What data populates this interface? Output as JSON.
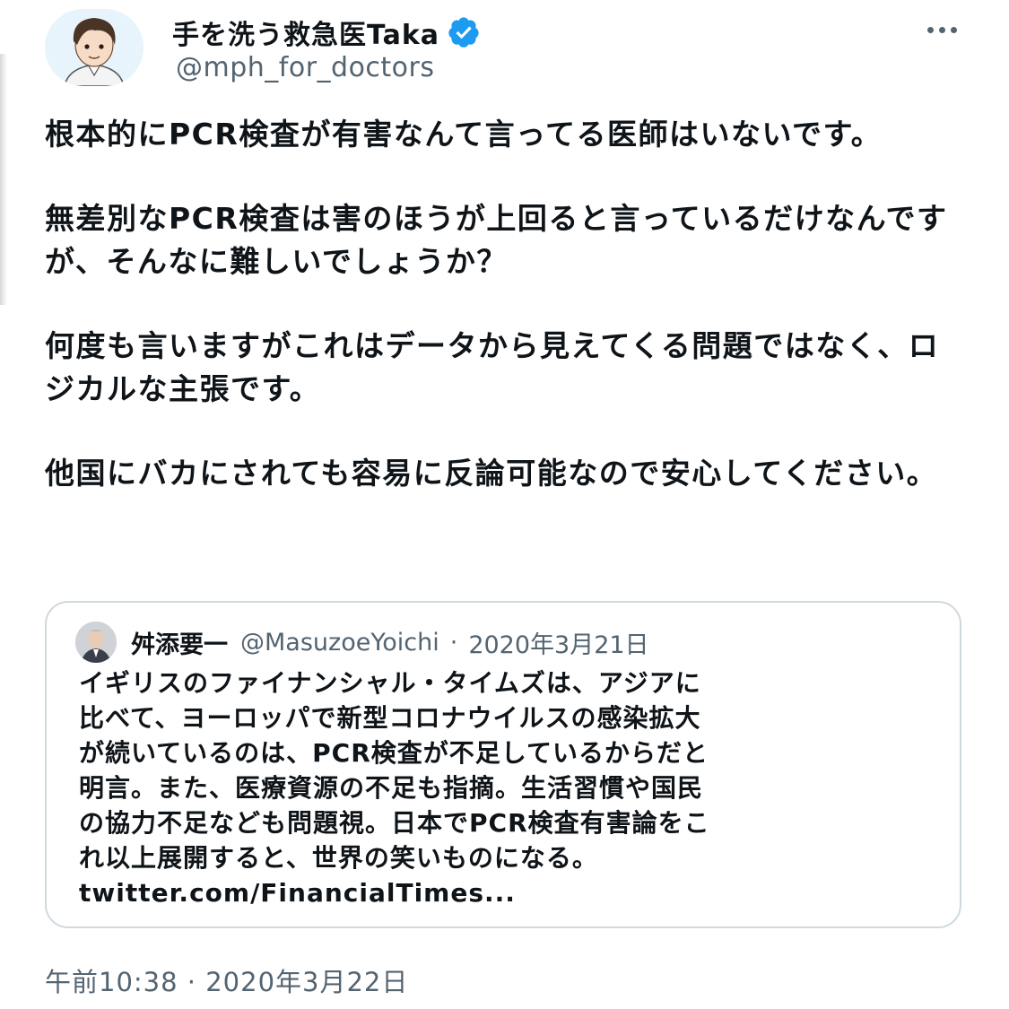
{
  "tweet": {
    "display_name": "手を洗う救急医Taka",
    "handle": "@mph_for_doctors",
    "avatar_icon": "illustrated-doctor-avatar",
    "verified_icon": "verified-badge-icon",
    "more_icon": "more-options-icon",
    "paragraphs": [
      "根本的にPCR検査が有害なんて言ってる医師はいないです。",
      "無差別なPCR検査は害のほうが上回ると言っているだけなんですが、そんなに難しいでしょうか？",
      "何度も言いますがこれはデータから見えてくる問題ではなく、ロジカルな主張です。",
      "他国にバカにされても容易に反論可能なので安心してください。"
    ],
    "timestamp": "午前10:38 · 2020年3月22日"
  },
  "quoted": {
    "display_name": "舛添要一",
    "handle": "@MasuzoeYoichi",
    "separator": "·",
    "date": "2020年3月21日",
    "lines": [
      "イギリスのファイナンシャル・タイムズは、アジアに",
      "比べて、ヨーロッパで新型コロナウイルスの感染拡大",
      "が続いているのは、PCR検査が不足しているからだと",
      "明言。また、医療資源の不足も指摘。生活習慣や国民",
      "の協力不足なども問題視。日本でPCR検査有害論をこ",
      "れ以上展開すると、世界の笑いものになる。",
      "twitter.com/FinancialTimes..."
    ]
  },
  "colors": {
    "text": "#0f1419",
    "secondary": "#536471",
    "verified": "#1d9bf0",
    "border": "#cfd9de"
  }
}
